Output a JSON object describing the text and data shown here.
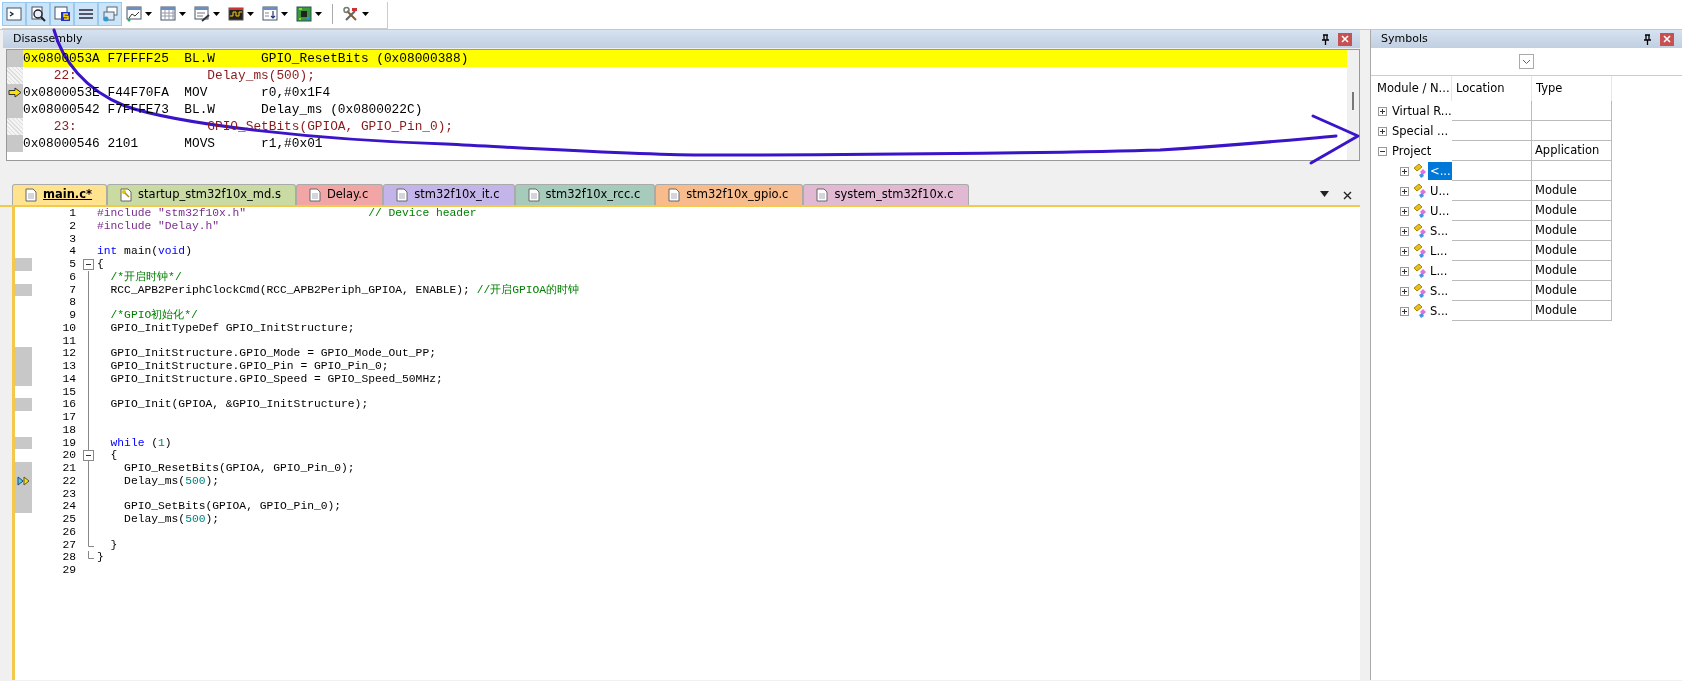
{
  "toolbar": [
    {
      "kind": "terminal",
      "selected": true,
      "dropdown": false
    },
    {
      "kind": "disassembly",
      "selected": true,
      "dropdown": false
    },
    {
      "kind": "symbols",
      "selected": true,
      "dropdown": false
    },
    {
      "kind": "registers",
      "selected": true,
      "dropdown": false
    },
    {
      "kind": "callstack",
      "selected": true,
      "dropdown": false
    },
    {
      "kind": "watch",
      "selected": false,
      "dropdown": true
    },
    {
      "kind": "memory",
      "selected": false,
      "dropdown": true
    },
    {
      "kind": "serial",
      "selected": false,
      "dropdown": true
    },
    {
      "kind": "analyzer",
      "selected": false,
      "dropdown": true
    },
    {
      "kind": "trace",
      "selected": false,
      "dropdown": true
    },
    {
      "kind": "chip",
      "selected": false,
      "dropdown": true
    },
    {
      "kind": "tools",
      "selected": false,
      "dropdown": true
    }
  ],
  "disassembly": {
    "title": "Disassembly",
    "lines": [
      {
        "kind": "instr",
        "text": "0x0800053A F7FFFF25  BL.W      GPIO_ResetBits (0x08000388)",
        "highlighted": true,
        "current": false
      },
      {
        "kind": "source",
        "text": "    22:                 Delay_ms(500);",
        "highlighted": false,
        "current": false
      },
      {
        "kind": "instr",
        "text": "0x0800053E F44F70FA  MOV       r0,#0x1F4",
        "highlighted": false,
        "current": true
      },
      {
        "kind": "instr",
        "text": "0x08000542 F7FFFE73  BL.W      Delay_ms (0x0800022C)",
        "highlighted": false,
        "current": false
      },
      {
        "kind": "source",
        "text": "    23:                 GPIO_SetBits(GPIOA, GPIO_Pin_0);",
        "highlighted": false,
        "current": false
      },
      {
        "kind": "instr",
        "text": "0x08000546 2101      MOVS      r1,#0x01",
        "highlighted": false,
        "current": false
      }
    ]
  },
  "editor": {
    "tabs": [
      {
        "label": "main.c*",
        "color": "#ffe38f",
        "selected": true,
        "kind": "file"
      },
      {
        "label": "startup_stm32f10x_md.s",
        "color": "#c9dba3",
        "selected": false,
        "kind": "key"
      },
      {
        "label": "Delay.c",
        "color": "#f2a5a5",
        "selected": false,
        "kind": "file"
      },
      {
        "label": "stm32f10x_it.c",
        "color": "#c3b5ea",
        "selected": false,
        "kind": "file"
      },
      {
        "label": "stm32f10x_rcc.c",
        "color": "#a6cbbb",
        "selected": false,
        "kind": "file"
      },
      {
        "label": "stm32f10x_gpio.c",
        "color": "#f7bb8c",
        "selected": false,
        "kind": "file"
      },
      {
        "label": "system_stm32f10x.c",
        "color": "#e2b9d2",
        "selected": false,
        "kind": "file"
      }
    ],
    "lines": [
      {
        "number": "1",
        "kind": "code",
        "marked": false,
        "current": false,
        "tokens": [
          {
            "kind": "pp",
            "text": "#include "
          },
          {
            "kind": "str",
            "text": "\"stm32f10x.h\""
          },
          {
            "kind": "comment",
            "text": "                  // Device header"
          }
        ]
      },
      {
        "number": "2",
        "kind": "code",
        "marked": false,
        "current": false,
        "tokens": [
          {
            "kind": "pp",
            "text": "#include "
          },
          {
            "kind": "str",
            "text": "\"Delay.h\""
          }
        ]
      },
      {
        "number": "3",
        "kind": "code",
        "marked": false,
        "current": false
      },
      {
        "number": "4",
        "kind": "code",
        "marked": false,
        "current": false,
        "tokens": [
          {
            "kind": "kw",
            "text": "int"
          },
          {
            "kind": "plain",
            "text": " main("
          },
          {
            "kind": "kw",
            "text": "void"
          },
          {
            "kind": "plain",
            "text": ")"
          }
        ]
      },
      {
        "number": "5",
        "kind": "fold_start",
        "marked": true,
        "current": false,
        "tokens": [
          {
            "kind": "plain",
            "text": "{"
          }
        ]
      },
      {
        "number": "6",
        "kind": "code",
        "marked": false,
        "current": false,
        "tokens": [
          {
            "kind": "comment",
            "text": "  /*开启时钟*/"
          }
        ]
      },
      {
        "number": "7",
        "kind": "code",
        "marked": true,
        "current": false,
        "tokens": [
          {
            "kind": "plain",
            "text": "  RCC_APB2PeriphClockCmd(RCC_APB2Periph_GPIOA, ENABLE); "
          },
          {
            "kind": "comment",
            "text": "//开启GPIOA的时钟"
          }
        ]
      },
      {
        "number": "8",
        "kind": "code",
        "marked": false,
        "current": false
      },
      {
        "number": "9",
        "kind": "code",
        "marked": false,
        "current": false,
        "tokens": [
          {
            "kind": "comment",
            "text": "  /*GPIO初始化*/"
          }
        ]
      },
      {
        "number": "10",
        "kind": "code",
        "marked": false,
        "current": false,
        "tokens": [
          {
            "kind": "plain",
            "text": "  GPIO_InitTypeDef GPIO_InitStructure;"
          }
        ]
      },
      {
        "number": "11",
        "kind": "code",
        "marked": false,
        "current": false
      },
      {
        "number": "12",
        "kind": "code",
        "marked": true,
        "current": false,
        "tokens": [
          {
            "kind": "plain",
            "text": "  GPIO_InitStructure.GPIO_Mode = GPIO_Mode_Out_PP;"
          }
        ]
      },
      {
        "number": "13",
        "kind": "code",
        "marked": true,
        "current": false,
        "tokens": [
          {
            "kind": "plain",
            "text": "  GPIO_InitStructure.GPIO_Pin = GPIO_Pin_0;"
          }
        ]
      },
      {
        "number": "14",
        "kind": "code",
        "marked": true,
        "current": false,
        "tokens": [
          {
            "kind": "plain",
            "text": "  GPIO_InitStructure.GPIO_Speed = GPIO_Speed_50MHz;"
          }
        ]
      },
      {
        "number": "15",
        "kind": "code",
        "marked": false,
        "current": false
      },
      {
        "number": "16",
        "kind": "code",
        "marked": true,
        "current": false,
        "tokens": [
          {
            "kind": "plain",
            "text": "  GPIO_Init(GPIOA, &GPIO_InitStructure);"
          }
        ]
      },
      {
        "number": "17",
        "kind": "code",
        "marked": false,
        "current": false
      },
      {
        "number": "18",
        "kind": "code",
        "marked": false,
        "current": false
      },
      {
        "number": "19",
        "kind": "code",
        "marked": true,
        "current": false,
        "tokens": [
          {
            "kind": "kw",
            "text": "  while"
          },
          {
            "kind": "plain",
            "text": " ("
          },
          {
            "kind": "num",
            "text": "1"
          },
          {
            "kind": "plain",
            "text": ")"
          }
        ]
      },
      {
        "number": "20",
        "kind": "fold_start",
        "marked": false,
        "current": false,
        "tokens": [
          {
            "kind": "plain",
            "text": "  {"
          }
        ]
      },
      {
        "number": "21",
        "kind": "code",
        "marked": true,
        "current": false,
        "tokens": [
          {
            "kind": "plain",
            "text": "    GPIO_ResetBits(GPIOA, GPIO_Pin_0);"
          }
        ]
      },
      {
        "number": "22",
        "kind": "code",
        "marked": true,
        "current": true,
        "tokens": [
          {
            "kind": "plain",
            "text": "    Delay_ms("
          },
          {
            "kind": "num",
            "text": "500"
          },
          {
            "kind": "plain",
            "text": ");"
          }
        ]
      },
      {
        "number": "23",
        "kind": "code",
        "marked": true,
        "current": false
      },
      {
        "number": "24",
        "kind": "code",
        "marked": true,
        "current": false,
        "tokens": [
          {
            "kind": "plain",
            "text": "    GPIO_SetBits(GPIOA, GPIO_Pin_0);"
          }
        ]
      },
      {
        "number": "25",
        "kind": "code",
        "marked": false,
        "current": false,
        "tokens": [
          {
            "kind": "plain",
            "text": "    Delay_ms("
          },
          {
            "kind": "num",
            "text": "500"
          },
          {
            "kind": "plain",
            "text": ");"
          }
        ]
      },
      {
        "number": "26",
        "kind": "code",
        "marked": false,
        "current": false
      },
      {
        "number": "27",
        "kind": "fold_end",
        "marked": false,
        "current": false,
        "tokens": [
          {
            "kind": "plain",
            "text": "  }"
          }
        ]
      },
      {
        "number": "28",
        "kind": "fold_end",
        "marked": false,
        "current": false,
        "tokens": [
          {
            "kind": "plain",
            "text": "}"
          }
        ]
      },
      {
        "number": "29",
        "kind": "code",
        "marked": false,
        "current": false
      }
    ]
  },
  "symbols": {
    "title": "Symbols",
    "columns": [
      "Module / N...",
      "Location",
      "Type"
    ],
    "items": [
      {
        "name": "Virtual R...",
        "expanded": false,
        "selected": false
      },
      {
        "name": "Special ...",
        "expanded": false,
        "selected": false
      },
      {
        "name": "Project",
        "type": "Application",
        "expanded": true,
        "selected": false,
        "children": [
          {
            "name": "<...",
            "expanded": false,
            "selected": true
          },
          {
            "name": "U...",
            "type": "Module",
            "expanded": false,
            "selected": false
          },
          {
            "name": "U...",
            "type": "Module",
            "expanded": false,
            "selected": false
          },
          {
            "name": "S...",
            "type": "Module",
            "expanded": false,
            "selected": false
          },
          {
            "name": "L...",
            "type": "Module",
            "expanded": false,
            "selected": false
          },
          {
            "name": "L...",
            "type": "Module",
            "expanded": false,
            "selected": false
          },
          {
            "name": "S...",
            "type": "Module",
            "expanded": false,
            "selected": false
          },
          {
            "name": "S...",
            "type": "Module",
            "expanded": false,
            "selected": false
          }
        ]
      }
    ]
  },
  "annotation": {
    "kind": "arrow"
  }
}
